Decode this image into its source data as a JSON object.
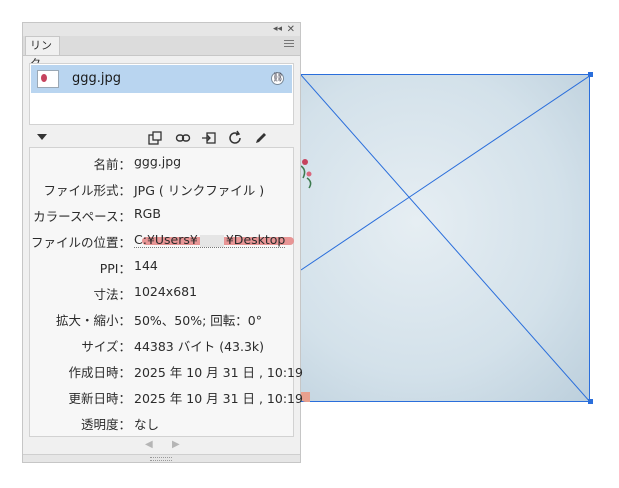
{
  "panel": {
    "tab_label": "リンク",
    "collapse_icon": "double-chevron-left-icon",
    "close_icon": "close-icon",
    "menu_icon": "hamburger-menu-icon"
  },
  "links": {
    "items": [
      {
        "name": "ggg.jpg",
        "status_icon": "link-chain-icon",
        "selected": true
      }
    ]
  },
  "toolbar": {
    "icons": [
      "relink-from-cc-icon",
      "relink-icon",
      "go-to-link-icon",
      "update-link-icon",
      "edit-original-icon"
    ]
  },
  "info": {
    "rows": [
      {
        "label": "名前：",
        "value": "ggg.jpg"
      },
      {
        "label": "ファイル形式：",
        "value": "JPG ( リンクファイル )"
      },
      {
        "label": "カラースペース：",
        "value": "RGB"
      },
      {
        "label": "ファイルの位置：",
        "value_prefix": "C:¥Users¥",
        "value_suffix": "¥Desktop"
      },
      {
        "label": "PPI：",
        "value": "144"
      },
      {
        "label": "寸法：",
        "value": "1024x681"
      },
      {
        "label": "拡大・縮小：",
        "value": "50%、50%; 回転：0°"
      },
      {
        "label": "サイズ：",
        "value": "44383 バイト (43.3k)"
      },
      {
        "label": "作成日時：",
        "value": "2025 年 10 月 31 日 , 10:19"
      },
      {
        "label": "更新日時：",
        "value": "2025 年 10 月 31 日 , 10:19"
      },
      {
        "label": "透明度：",
        "value": "なし"
      }
    ]
  },
  "colors": {
    "selection": "#b9d5f0",
    "frame": "#2a6edb",
    "highlight": "#e68a8a"
  }
}
